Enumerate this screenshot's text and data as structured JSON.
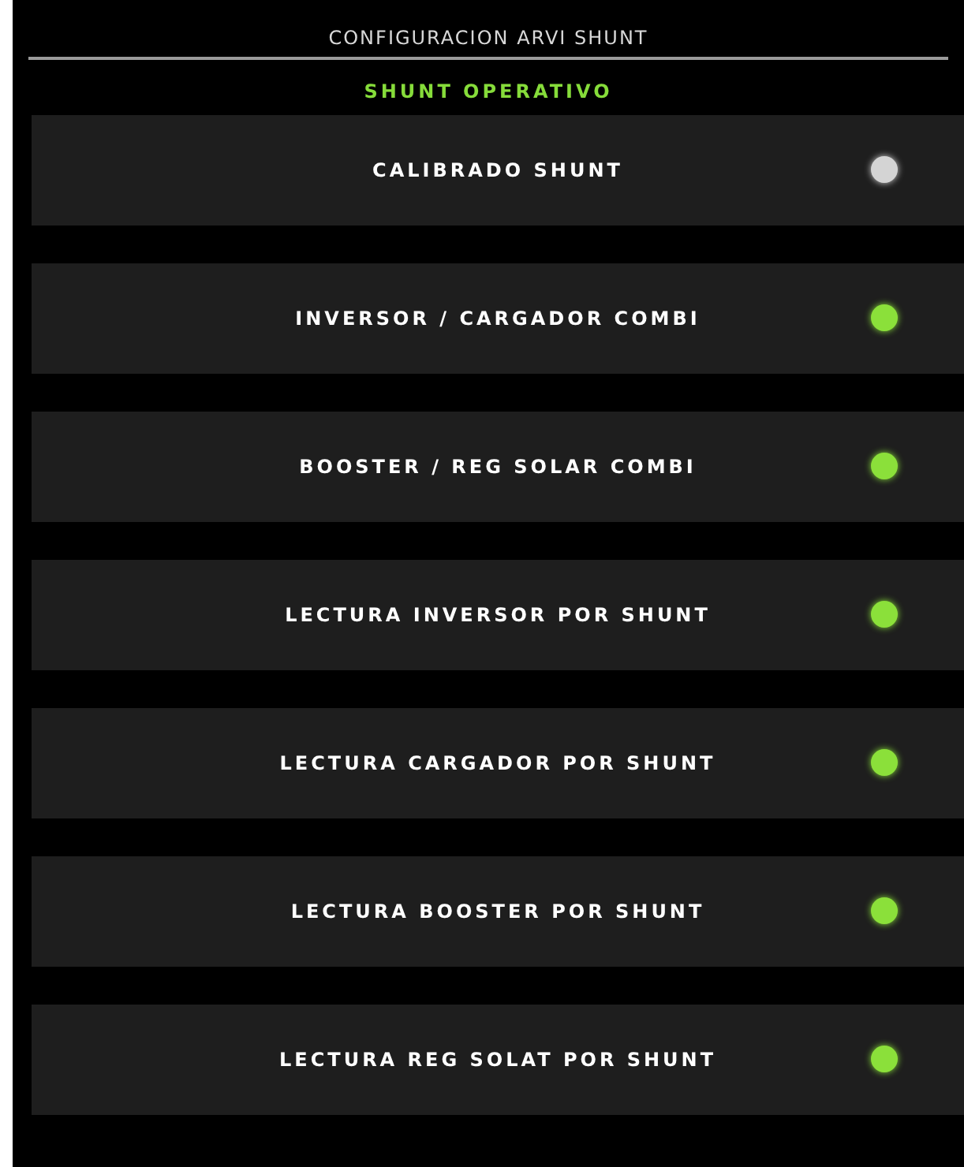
{
  "title": "CONFIGURACION ARVI SHUNT",
  "status": "SHUNT OPERATIVO",
  "items": [
    {
      "label": "CALIBRADO SHUNT",
      "on": false
    },
    {
      "label": "INVERSOR / CARGADOR COMBI",
      "on": true
    },
    {
      "label": "BOOSTER / REG SOLAR COMBI",
      "on": true
    },
    {
      "label": "LECTURA INVERSOR POR SHUNT",
      "on": true
    },
    {
      "label": "LECTURA CARGADOR POR SHUNT",
      "on": true
    },
    {
      "label": "LECTURA BOOSTER POR SHUNT",
      "on": true
    },
    {
      "label": "LECTURA REG SOLAT POR SHUNT",
      "on": true
    }
  ]
}
